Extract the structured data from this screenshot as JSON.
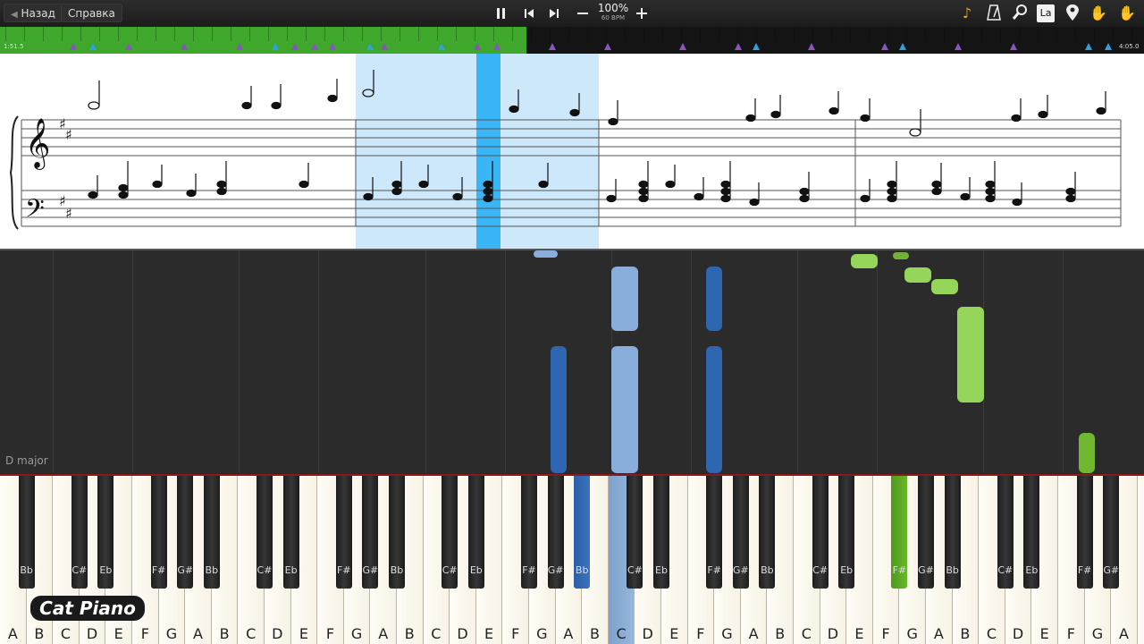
{
  "toolbar": {
    "back_label": "Назад",
    "help_label": "Справка",
    "tempo_percent": "100%",
    "tempo_bpm": "60 BPM",
    "right_icons": [
      "note-icon",
      "metronome-icon",
      "magnifier-icon",
      "la-icon",
      "map-pin-icon",
      "hand-icon",
      "hand-icon"
    ],
    "la_label": "La"
  },
  "timeline": {
    "current_time": "1:51.5",
    "total_time": "4:05.0",
    "progress_fraction": 0.46,
    "fill_color": "#3fa72c"
  },
  "roll": {
    "key_signature": "D major"
  },
  "keyboard": {
    "white_keys": [
      "A",
      "B",
      "C",
      "D",
      "E",
      "F",
      "G",
      "A",
      "B",
      "C",
      "D",
      "E",
      "F",
      "G",
      "A",
      "B",
      "C",
      "D",
      "E",
      "F",
      "G",
      "A",
      "B",
      "C",
      "D",
      "E",
      "F",
      "G",
      "A",
      "B",
      "C",
      "D",
      "E",
      "F",
      "G",
      "A",
      "B",
      "C",
      "D",
      "E",
      "F",
      "G",
      "A",
      "B"
    ],
    "black_keys": [
      "Bb",
      "C#",
      "Eb",
      "F#",
      "G#",
      "Bb",
      "C#",
      "Eb",
      "F#",
      "G#",
      "Bb",
      "C#",
      "Eb",
      "F#",
      "G#",
      "Bb",
      "C#",
      "Eb",
      "F#",
      "G#",
      "Bb",
      "C#",
      "Eb",
      "F#",
      "G#",
      "Bb",
      "C#",
      "Eb",
      "F#",
      "G#"
    ]
  },
  "colors": {
    "light_blue": "#8aaedb",
    "dark_blue": "#2f66b2",
    "green": "#95d55a",
    "score_highlight": "#cce8fa",
    "cursor": "#3ab5f5"
  },
  "branding": {
    "logo": "Cat Piano"
  }
}
